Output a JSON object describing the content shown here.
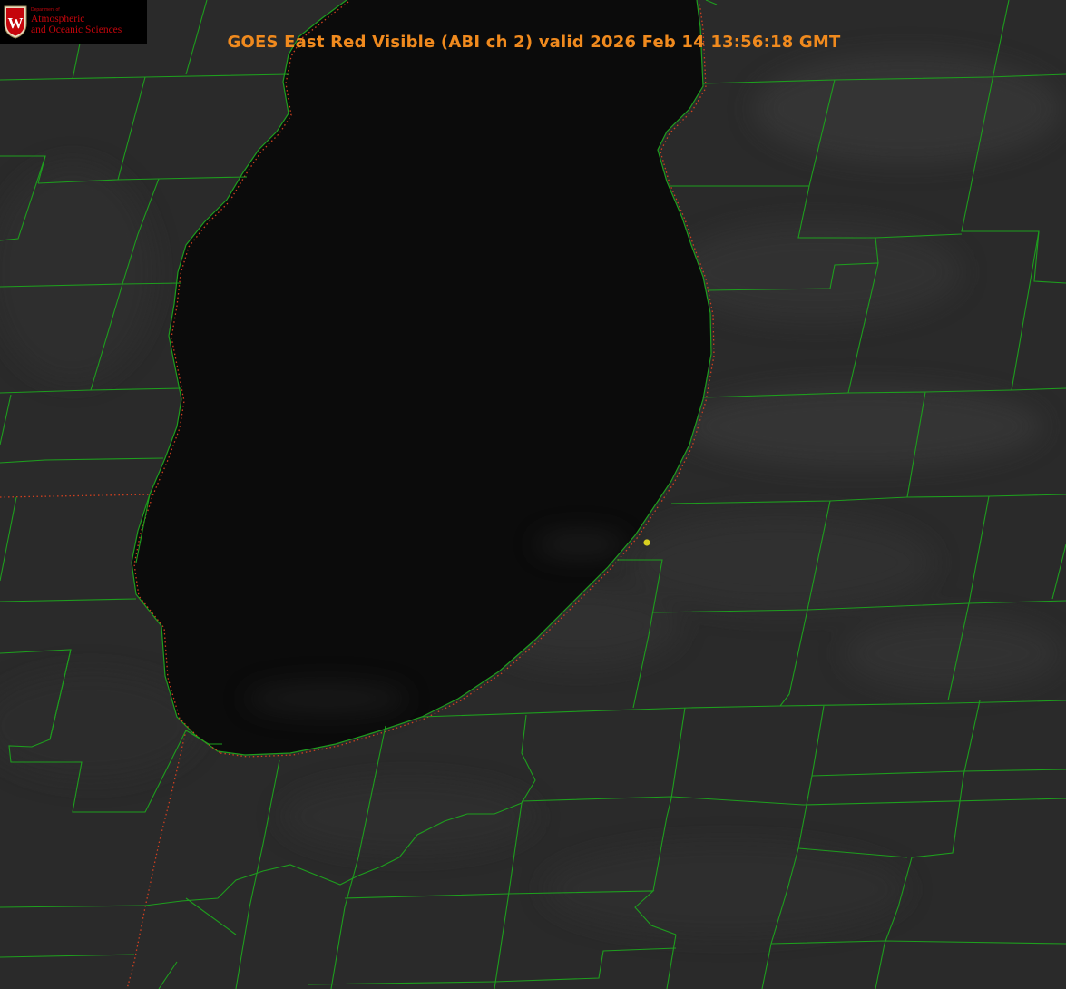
{
  "title": "GOES East Red Visible (ABI ch 2) valid 2026 Feb 14 13:56:18 GMT",
  "logo": {
    "crest_letter": "W",
    "department_small": "Department of",
    "line1": "Atmospheric",
    "line2": "and Oceanic Sciences"
  },
  "colors": {
    "land": "#2b2b2b",
    "lake": "#0a0a0a",
    "county_lines": "#1e9e1e",
    "state_lines": "#d04020",
    "title": "#f08a1e",
    "marker": "#d8d020",
    "logo_text": "#c5050c"
  },
  "map": {
    "marker_icon": "location-dot-icon"
  }
}
